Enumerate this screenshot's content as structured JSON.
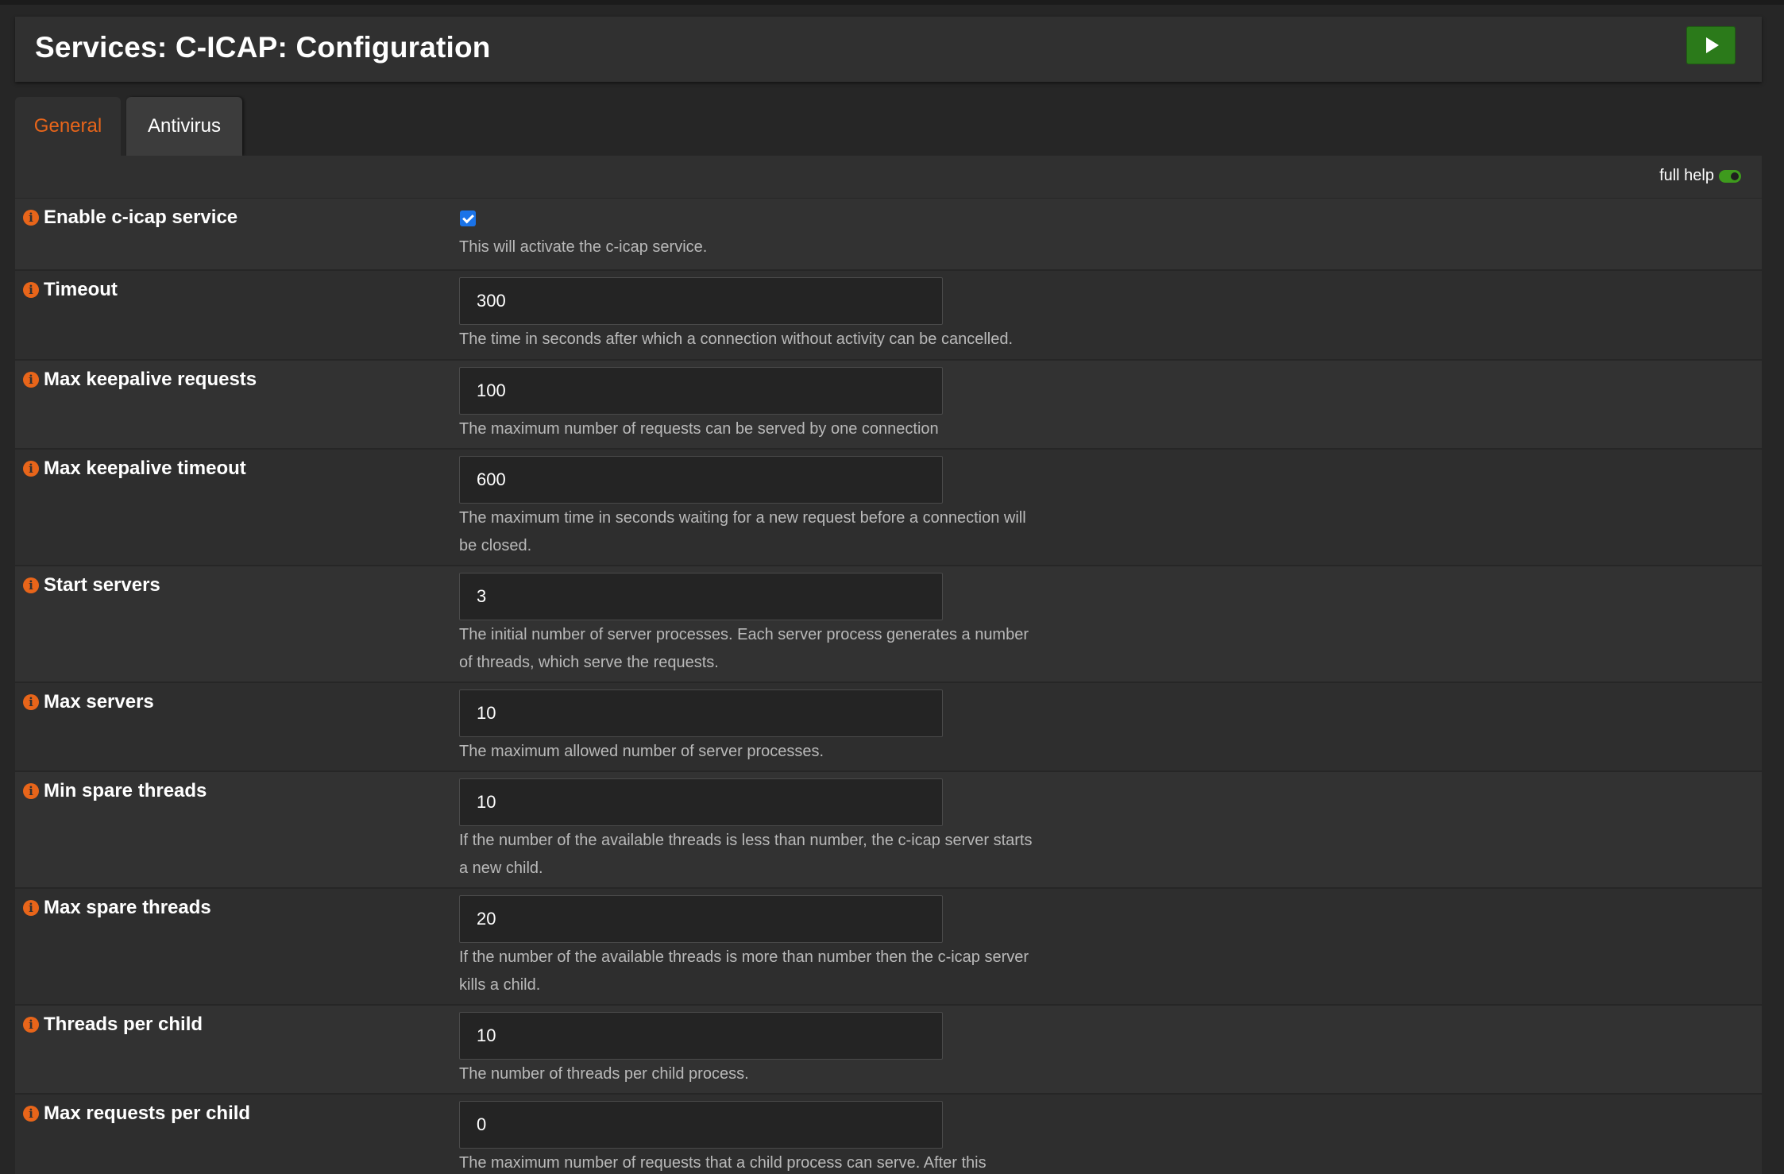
{
  "header": {
    "title": "Services: C-ICAP: Configuration"
  },
  "tabs": [
    {
      "label": "General"
    },
    {
      "label": "Antivirus"
    }
  ],
  "help_toggle": {
    "label": "full help"
  },
  "colors": {
    "accent": "#e8651a",
    "success": "#2b7a1a",
    "checkbox": "#1a73e8"
  },
  "fields": [
    {
      "label": "Enable c-icap service",
      "type": "checkbox",
      "checked": true,
      "help": "This will activate the c-icap service."
    },
    {
      "label": "Timeout",
      "value": "300",
      "help": "The time in seconds after which a connection without activity can be cancelled."
    },
    {
      "label": "Max keepalive requests",
      "value": "100",
      "help": "The maximum number of requests can be served by one connection"
    },
    {
      "label": "Max keepalive timeout",
      "value": "600",
      "help": "The maximum time in seconds waiting for a new request before a connection will be closed."
    },
    {
      "label": "Start servers",
      "value": "3",
      "help": "The initial number of server processes. Each server process generates a number of threads, which serve the requests."
    },
    {
      "label": "Max servers",
      "value": "10",
      "help": "The maximum allowed number of server processes."
    },
    {
      "label": "Min spare threads",
      "value": "10",
      "help": "If the number of the available threads is less than number, the c-icap server starts a new child."
    },
    {
      "label": "Max spare threads",
      "value": "20",
      "help": "If the number of the available threads is more than number then the c-icap server kills a child."
    },
    {
      "label": "Threads per child",
      "value": "10",
      "help": "The number of threads per child process."
    },
    {
      "label": "Max requests per child",
      "value": "0",
      "help": "The maximum number of requests that a child process can serve. After this"
    }
  ]
}
